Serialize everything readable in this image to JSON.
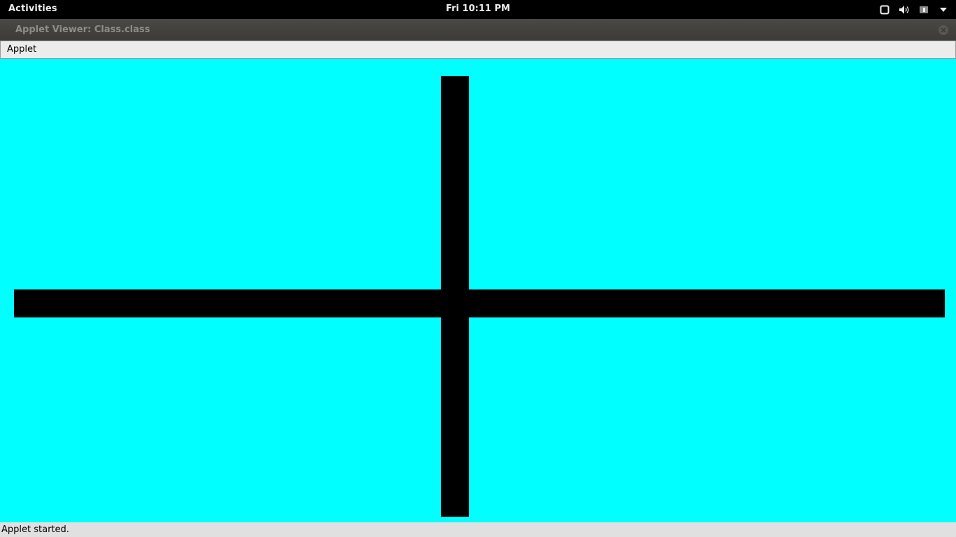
{
  "top_bar": {
    "activities_label": "Activities",
    "clock": "Fri 10:11 PM",
    "tray_icons": [
      "window-icon",
      "volume-icon",
      "battery-icon",
      "system-menu-icon"
    ]
  },
  "window": {
    "title": "Applet Viewer: Class.class",
    "close_icon": "close-icon"
  },
  "menu": {
    "items": [
      {
        "label": "Applet"
      }
    ]
  },
  "applet": {
    "background_color": "#00ffff",
    "shape_color": "#000000",
    "shapes": [
      "vertical-bar",
      "horizontal-bar"
    ]
  },
  "status": {
    "text": "Applet started."
  }
}
